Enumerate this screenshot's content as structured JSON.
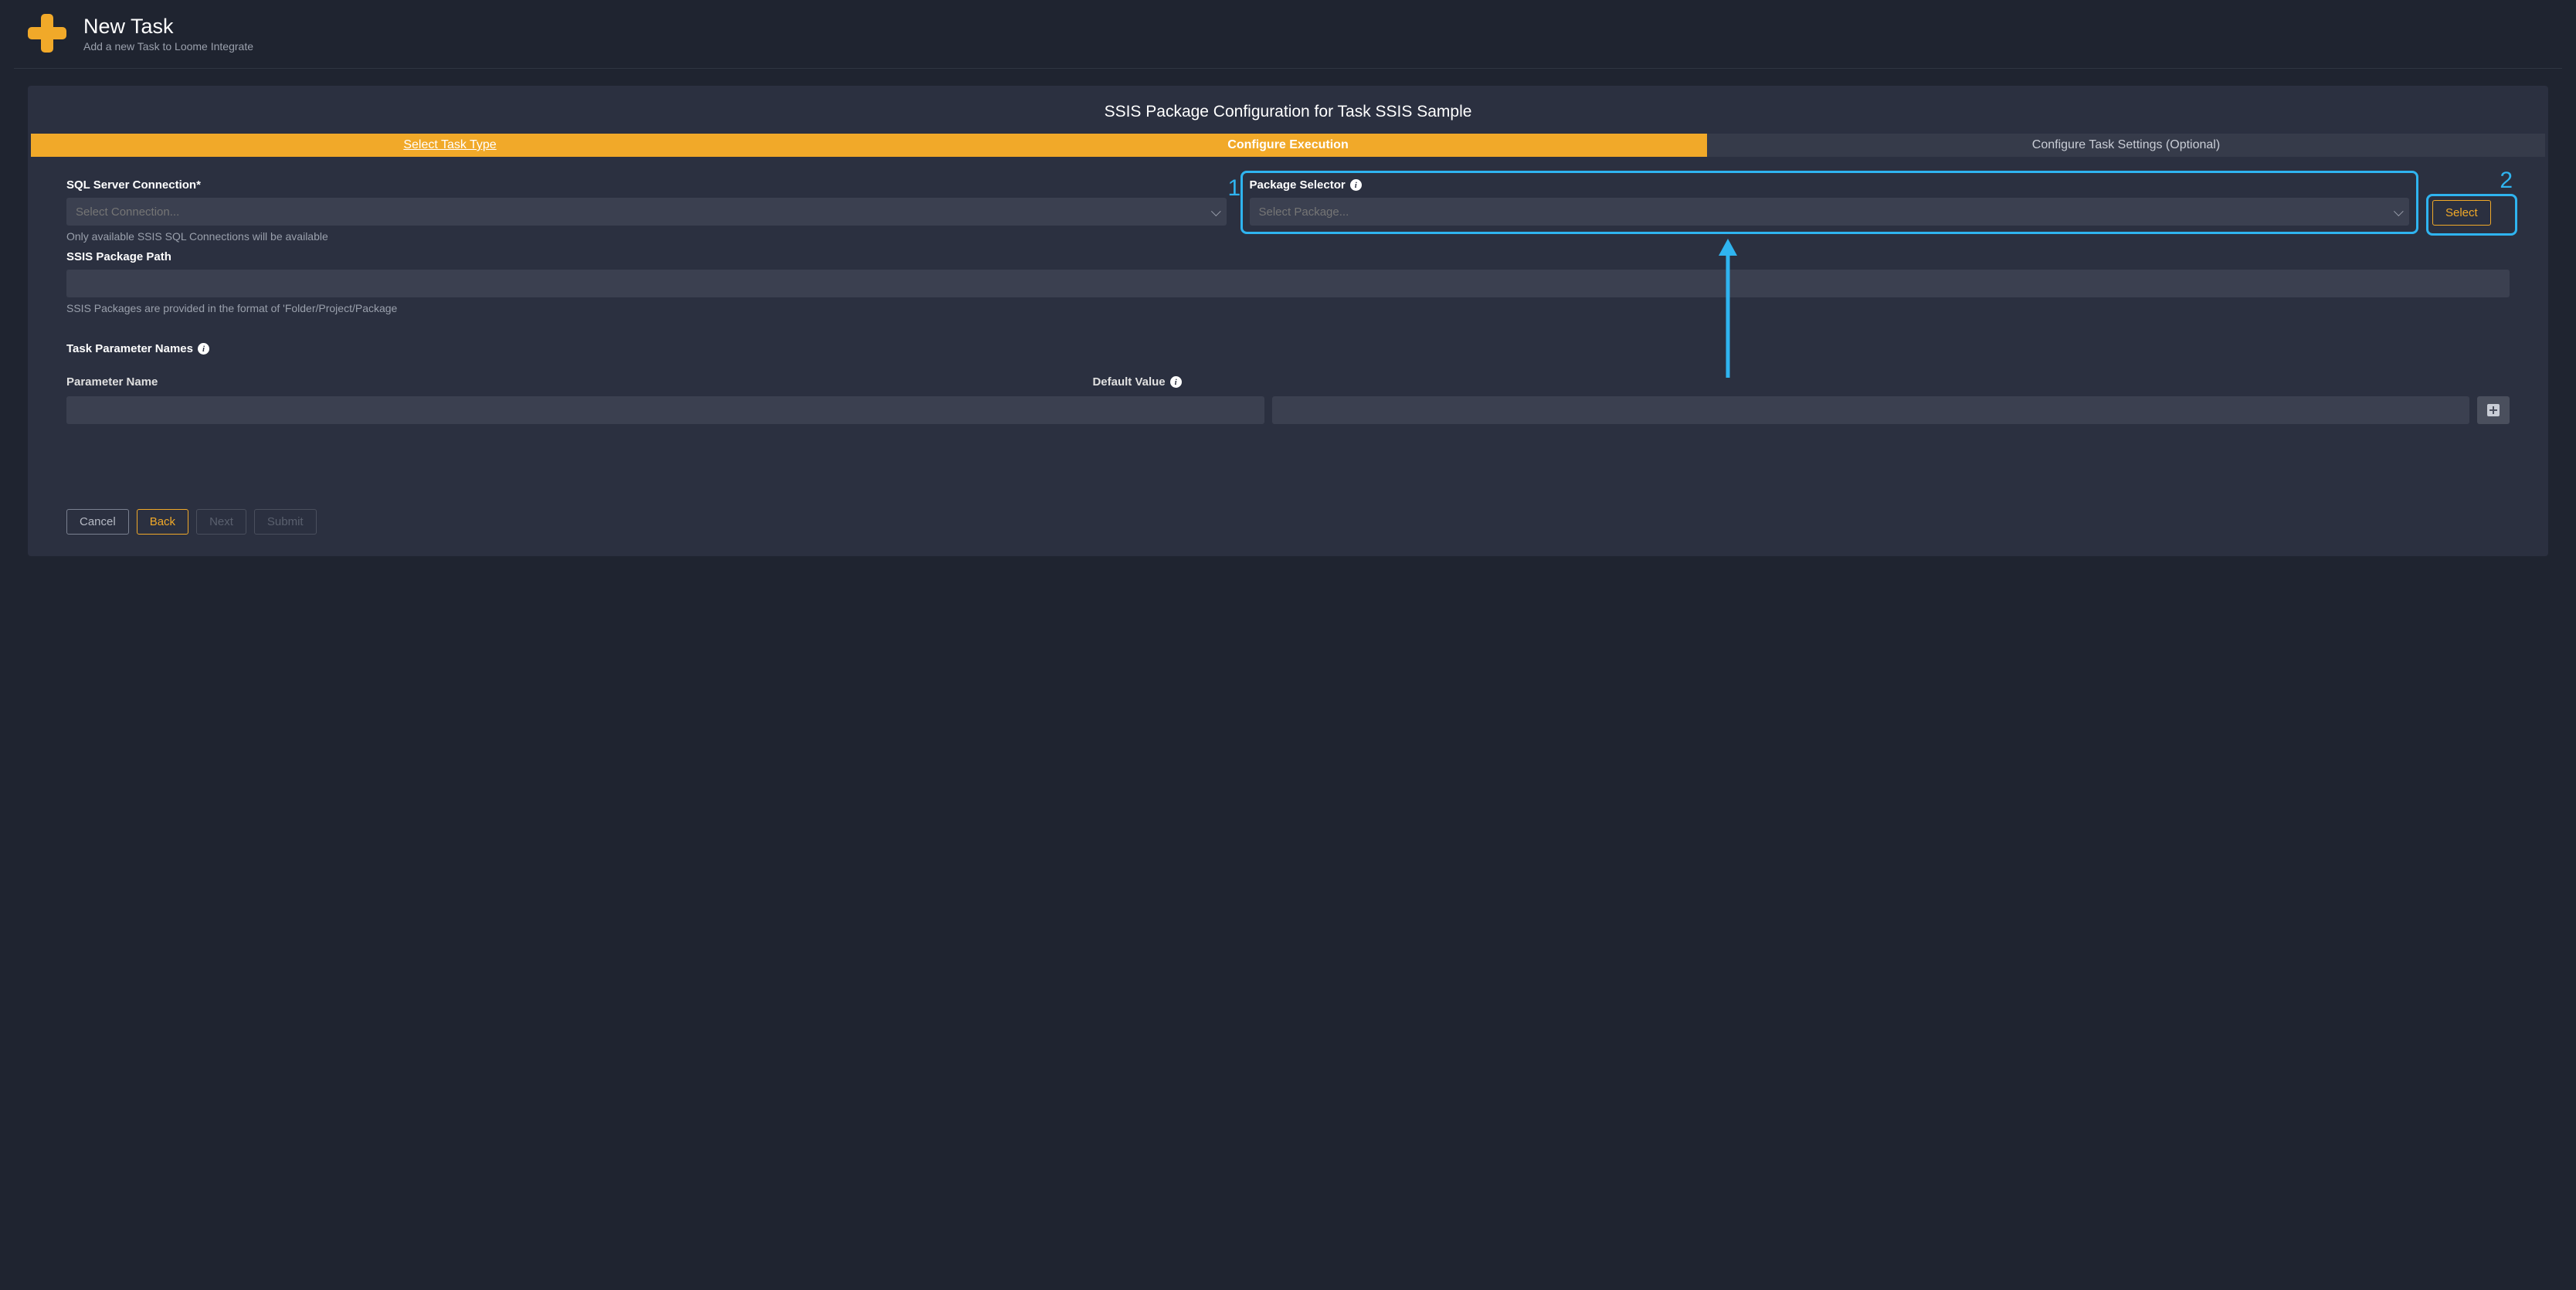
{
  "header": {
    "title": "New Task",
    "subtitle": "Add a new Task to Loome Integrate"
  },
  "panel": {
    "title": "SSIS Package Configuration for Task SSIS Sample",
    "tabs": [
      {
        "label": "Select Task Type"
      },
      {
        "label": "Configure Execution"
      },
      {
        "label": "Configure Task Settings (Optional)"
      }
    ],
    "sqlconn": {
      "label": "SQL Server Connection*",
      "placeholder": "Select Connection...",
      "hint": "Only available SSIS SQL Connections will be available"
    },
    "pkgsel": {
      "label": "Package Selector",
      "placeholder": "Select Package...",
      "select_btn": "Select"
    },
    "path": {
      "label": "SSIS Package Path",
      "hint": "SSIS Packages are provided in the format of 'Folder/Project/Package"
    },
    "params": {
      "label": "Task Parameter Names",
      "col1": "Parameter Name",
      "col2": "Default Value"
    },
    "buttons": {
      "cancel": "Cancel",
      "back": "Back",
      "next": "Next",
      "submit": "Submit"
    }
  },
  "callouts": {
    "one": "1",
    "two": "2"
  }
}
